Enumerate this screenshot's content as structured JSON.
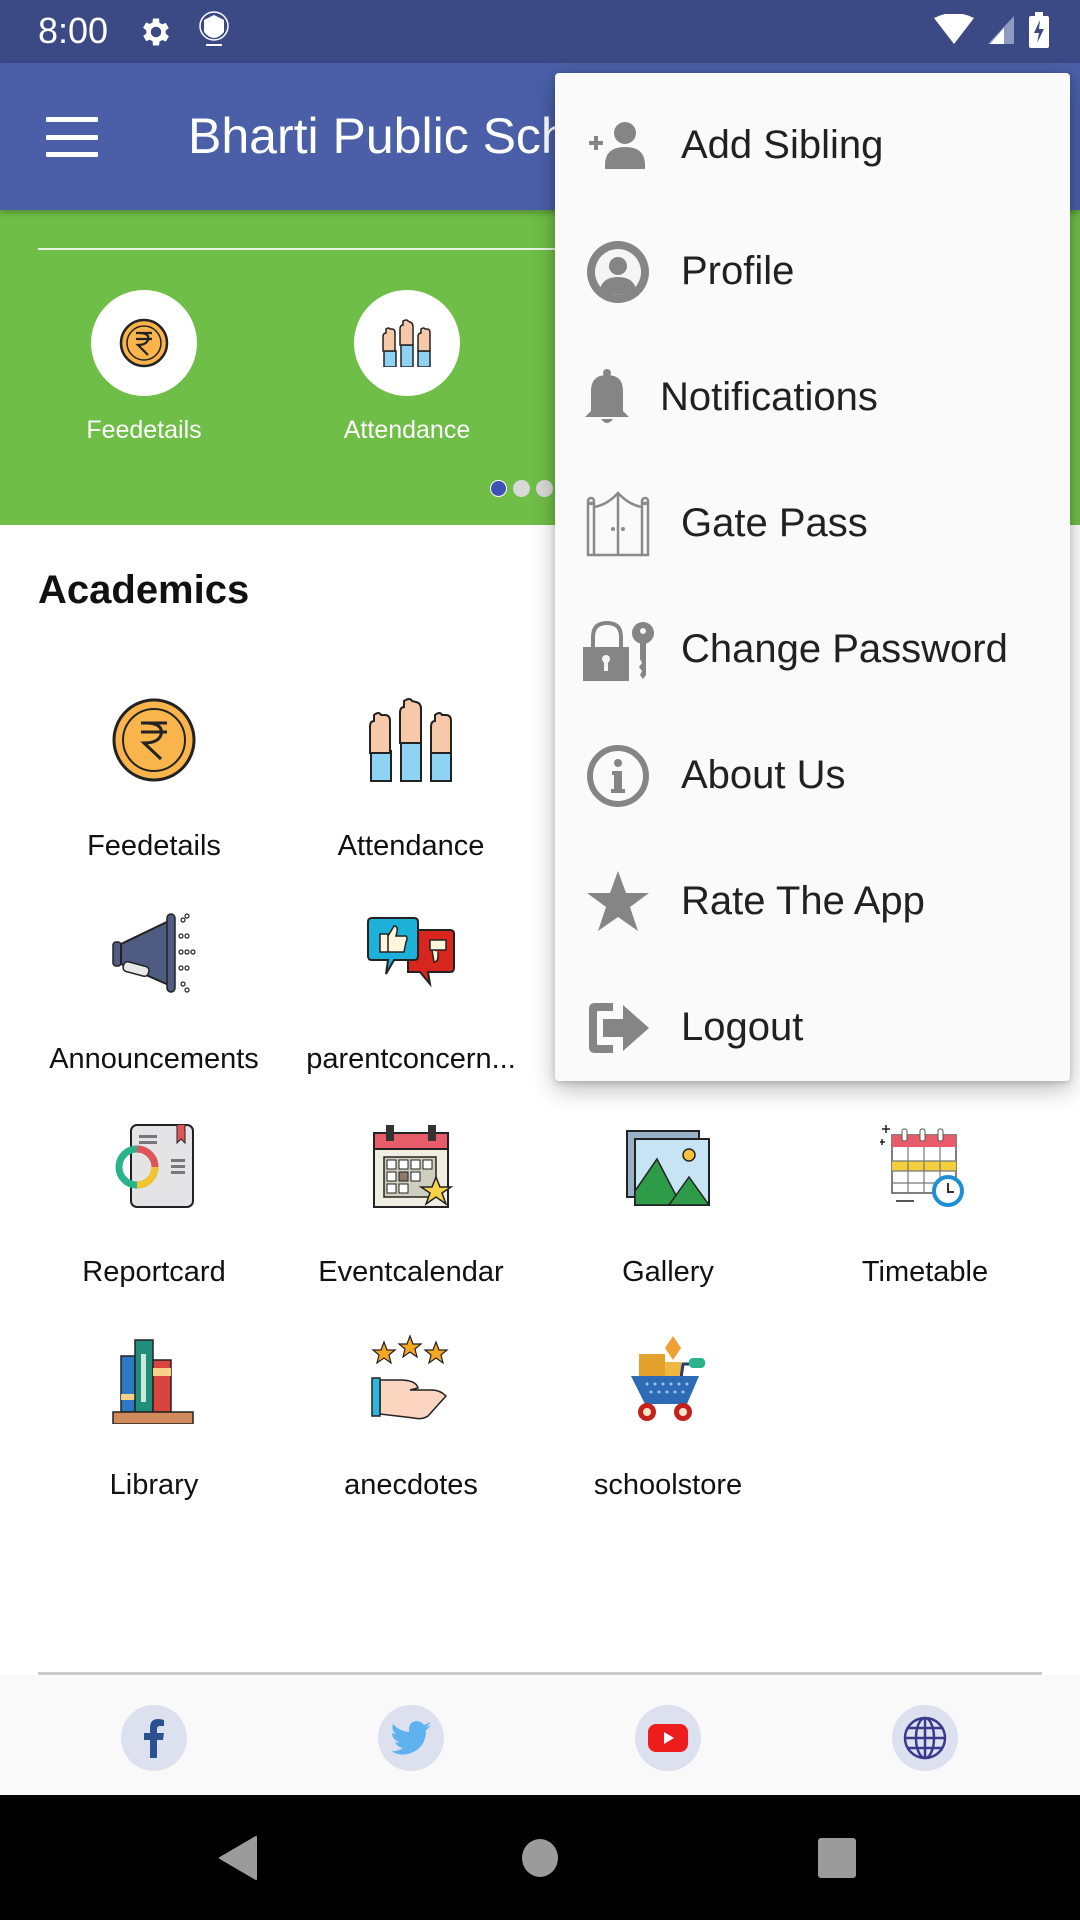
{
  "status_bar": {
    "time": "8:00",
    "left_icons": [
      "gear-icon",
      "shield-icon"
    ],
    "right_icons": [
      "wifi-icon",
      "signal-icon",
      "battery-charging-icon"
    ]
  },
  "app_bar": {
    "title": "Bharti Public School",
    "menu_icon": "hamburger-icon"
  },
  "banner": {
    "items": [
      {
        "label": "Feedetails",
        "icon": "rupee-coin-icon"
      },
      {
        "label": "Attendance",
        "icon": "raised-hands-icon"
      }
    ],
    "page_count": 3,
    "active_page": 1,
    "colors": {
      "background": "#6fbe47",
      "active_dot": "#3f51b5",
      "inactive_dot": "#d9d9d9"
    }
  },
  "academics": {
    "title": "Academics",
    "items": [
      {
        "label": "Feedetails",
        "icon": "rupee-coin-icon"
      },
      {
        "label": "Attendance",
        "icon": "raised-hands-icon"
      },
      {
        "label": "Announcements",
        "icon": "megaphone-icon"
      },
      {
        "label": "parentconcern...",
        "icon": "feedback-thumbs-icon"
      },
      {
        "label": "Reportcard",
        "icon": "report-card-icon"
      },
      {
        "label": "Eventcalendar",
        "icon": "event-calendar-icon"
      },
      {
        "label": "Gallery",
        "icon": "gallery-icon"
      },
      {
        "label": "Timetable",
        "icon": "timetable-icon"
      },
      {
        "label": "Library",
        "icon": "books-icon"
      },
      {
        "label": "anecdotes",
        "icon": "stars-hand-icon"
      },
      {
        "label": "schoolstore",
        "icon": "shopping-cart-icon"
      }
    ]
  },
  "footer": {
    "social": [
      {
        "name": "facebook",
        "icon": "facebook-icon"
      },
      {
        "name": "twitter",
        "icon": "twitter-icon"
      },
      {
        "name": "youtube",
        "icon": "youtube-icon"
      },
      {
        "name": "website",
        "icon": "globe-icon"
      }
    ]
  },
  "nav_bar": {
    "buttons": [
      "back",
      "home",
      "recents"
    ]
  },
  "menu": {
    "items": [
      {
        "label": "Add Sibling",
        "icon": "add-person-icon"
      },
      {
        "label": "Profile",
        "icon": "profile-icon"
      },
      {
        "label": "Notifications",
        "icon": "bell-icon"
      },
      {
        "label": "Gate Pass",
        "icon": "gate-icon"
      },
      {
        "label": "Change Password",
        "icon": "lock-key-icon"
      },
      {
        "label": "About Us",
        "icon": "info-icon"
      },
      {
        "label": "Rate The App",
        "icon": "star-icon"
      },
      {
        "label": "Logout",
        "icon": "logout-icon"
      }
    ]
  },
  "colors": {
    "status_bar": "#3b4a85",
    "app_bar": "#4a5fa8",
    "menu_icon_gray": "#858585"
  }
}
